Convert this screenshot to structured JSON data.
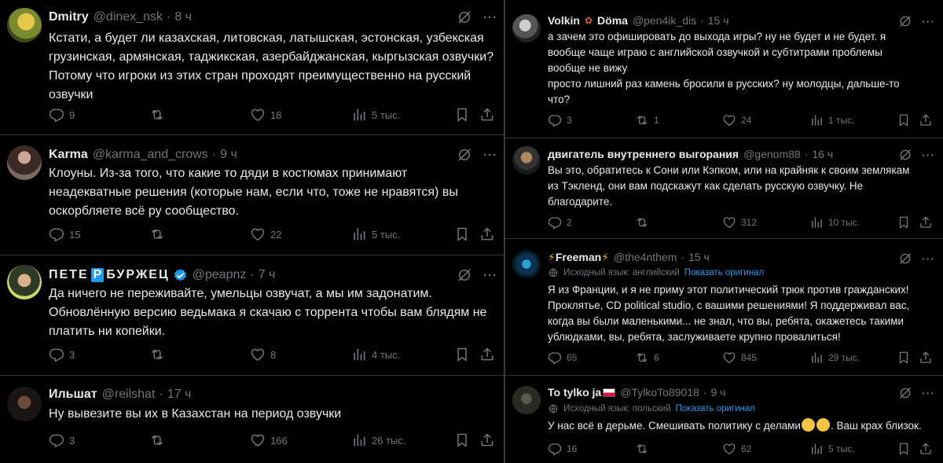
{
  "left": [
    {
      "name": "Dmitry",
      "handle": "@dinex_nsk",
      "time": "8 ч",
      "text": "Кстати, а будет ли  казахская, литовская, латышская, эстонская, узбекская грузинская, армянская, таджикская, азербайджанская, кыргызская озвучки? Потому что игроки из этих стран проходят преимущественно на русский озвучки",
      "replies": "9",
      "retweets": "",
      "likes": "18",
      "views": "5 тыс."
    },
    {
      "name": "Karma",
      "handle": "@karma_and_crows",
      "time": "9 ч",
      "text": "Клоуны. Из-за того, что какие то дяди в костюмах принимают неадекватные решения (которые нам, если что, тоже не нравятся) вы оскорбляете всё ру сообщество.",
      "replies": "15",
      "retweets": "",
      "likes": "22",
      "views": "5 тыс."
    },
    {
      "name_a": "ПЕТЕ",
      "name_box": "Р",
      "name_b": "БУРЖЕЦ",
      "handle": "@peapnz",
      "time": "7 ч",
      "text": "Да ничего не переживайте, умельцы озвучат, а мы им задонатим. Обновлённую версию ведьмака я скачаю с торрента чтобы вам блядям не платить ни копейки.",
      "replies": "3",
      "retweets": "",
      "likes": "8",
      "views": "4 тыс."
    },
    {
      "name": "Ильшат",
      "handle": "@reilshat",
      "time": "17 ч",
      "text": "Ну вывезите вы их в Казахстан на период озвучки",
      "replies": "3",
      "retweets": "",
      "likes": "166",
      "views": "26 тыс."
    }
  ],
  "right": [
    {
      "name_a": "Volkin",
      "name_b": "Döma",
      "handle": "@pen4ik_dis",
      "time": "15 ч",
      "text": "а зачем это офишировать до выхода игры? ну не будет и не будет. я вообще чаще играю с английской озвучкой и субтитрами проблемы вообще не вижу\nпросто лишний раз камень бросили в русских? ну молодцы, дальше-то что?",
      "replies": "3",
      "retweets": "1",
      "likes": "24",
      "views": "1 тыс."
    },
    {
      "name": "двигатель внутреннего выгорания",
      "handle": "@genom88",
      "time": "16 ч",
      "text": "Вы это, обратитесь к Сони или Кэпком, или на крайняк к своим землякам из Тэкленд, они вам подскажут как сделать русскую озвучку. Не благодарите.",
      "replies": "2",
      "retweets": "",
      "likes": "312",
      "views": "10 тыс."
    },
    {
      "name": "Freeman",
      "bolt": "⚡",
      "handle": "@the4nthem",
      "time": "15 ч",
      "translation": "Исходный язык: английский",
      "show_original": "Показать оригинал",
      "text": "Я из Франции, и я не приму этот политический трюк против гражданских! Проклятье, CD political studio, с вашими решениями! Я поддерживал вас, когда вы были маленькими... не знал, что вы, ребята, окажетесь такими ублюдками, вы, ребята, заслуживаете крупно провалиться!",
      "replies": "65",
      "retweets": "6",
      "likes": "845",
      "views": "29 тыс."
    },
    {
      "name": "To tylko ja",
      "handle": "@TylkoTo89018",
      "time": "9 ч",
      "translation": "Исходный язык: польский",
      "show_original": "Показать оригинал",
      "text_a": "У нас всё в дерьме. Смешивать политику с делами",
      "text_b": ". Ваш крах близок.",
      "replies": "16",
      "retweets": "",
      "likes": "62",
      "views": "5 тыс."
    }
  ],
  "icons": {
    "reply": "reply-icon",
    "retweet": "retweet-icon",
    "like": "heart-icon",
    "views": "views-icon",
    "bookmark": "bookmark-icon",
    "share": "share-icon",
    "grok": "grok-icon",
    "more": "more-icon"
  },
  "more_label": "···",
  "colors": {
    "bg": "#000000",
    "text": "#e7e9ea",
    "muted": "#71767b",
    "link": "#1d9bf0",
    "divider": "#2f3336"
  }
}
